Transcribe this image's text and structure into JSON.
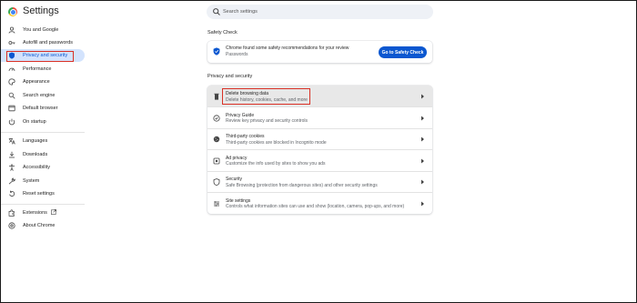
{
  "header": {
    "title": "Settings",
    "search_placeholder": "Search settings"
  },
  "sidebar": {
    "items": [
      {
        "label": "You and Google",
        "icon": "person-icon"
      },
      {
        "label": "Autofill and passwords",
        "icon": "key-icon"
      },
      {
        "label": "Privacy and security",
        "icon": "shield-icon",
        "active": true
      },
      {
        "label": "Performance",
        "icon": "speedometer-icon"
      },
      {
        "label": "Appearance",
        "icon": "palette-icon"
      },
      {
        "label": "Search engine",
        "icon": "search-icon"
      },
      {
        "label": "Default browser",
        "icon": "browser-icon"
      },
      {
        "label": "On startup",
        "icon": "power-icon"
      },
      {
        "label": "Languages",
        "icon": "language-icon"
      },
      {
        "label": "Downloads",
        "icon": "download-icon"
      },
      {
        "label": "Accessibility",
        "icon": "accessibility-icon"
      },
      {
        "label": "System",
        "icon": "wrench-icon"
      },
      {
        "label": "Reset settings",
        "icon": "reset-icon"
      },
      {
        "label": "Extensions",
        "icon": "puzzle-icon"
      },
      {
        "label": "About Chrome",
        "icon": "chrome-icon"
      }
    ]
  },
  "safety_check": {
    "section_title": "Safety Check",
    "text": "Chrome found some safety recommendations for your review",
    "subtext": "Passwords",
    "button_label": "Go to Safety Check"
  },
  "privacy": {
    "section_title": "Privacy and security",
    "rows": [
      {
        "title": "Delete browsing data",
        "subtitle": "Delete history, cookies, cache, and more",
        "icon": "trash-icon"
      },
      {
        "title": "Privacy Guide",
        "subtitle": "Review key privacy and security controls",
        "icon": "privacy-guide-icon"
      },
      {
        "title": "Third-party cookies",
        "subtitle": "Third-party cookies are blocked in Incognito mode",
        "icon": "cookie-icon"
      },
      {
        "title": "Ad privacy",
        "subtitle": "Customize the info used by sites to show you ads",
        "icon": "ad-privacy-icon"
      },
      {
        "title": "Security",
        "subtitle": "Safe Browsing (protection from dangerous sites) and other security settings",
        "icon": "security-shield-icon"
      },
      {
        "title": "Site settings",
        "subtitle": "Controls what information sites can use and show (location, camera, pop-ups, and more)",
        "icon": "sliders-icon"
      }
    ]
  },
  "colors": {
    "accent": "#0b57d0",
    "active_bg": "#d3e3fd",
    "highlight_outline": "#d93025"
  }
}
